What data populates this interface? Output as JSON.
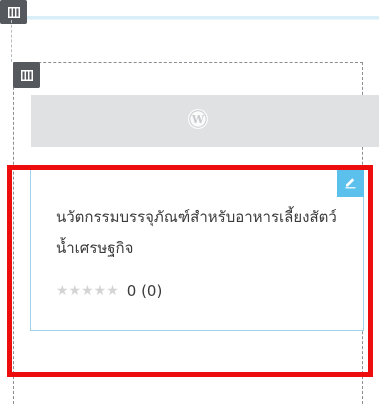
{
  "product": {
    "title": "นวัตกรรมบรรจุภัณฑ์สำหรับอาหารเลี้ยงสัตว์น้ำเศรษฐกิจ",
    "stars": "★★★★★",
    "rating": 0,
    "rating_count": "0 (0)"
  },
  "colors": {
    "handle": "#55585d",
    "edit_button": "#5bc0eb",
    "highlight": "#ee0d0d",
    "card_border": "#9fd3ea",
    "placeholder": "#dfe1e3"
  },
  "icons": {
    "section_handle": "columns-icon",
    "column_handle": "columns-icon",
    "image_placeholder": "wordpress-icon",
    "edit": "pencil-icon"
  }
}
